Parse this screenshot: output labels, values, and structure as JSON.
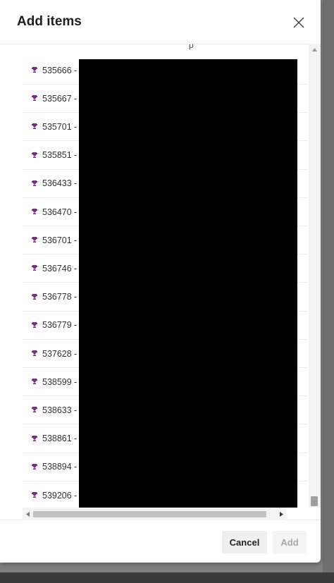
{
  "dialog": {
    "title": "Add items",
    "close_icon": "close-icon"
  },
  "list": {
    "clipped_top_text": "p",
    "item_icon": "trophy-icon",
    "item_icon_color": "#7b2a8c",
    "items": [
      {
        "id": "535666 -"
      },
      {
        "id": "535667 -"
      },
      {
        "id": "535701 -"
      },
      {
        "id": "535851 -"
      },
      {
        "id": "536433 -"
      },
      {
        "id": "536470 -"
      },
      {
        "id": "536701 -"
      },
      {
        "id": "536746 -"
      },
      {
        "id": "536778 -"
      },
      {
        "id": "536779 -"
      },
      {
        "id": "537628 -"
      },
      {
        "id": "538599 -"
      },
      {
        "id": "538633 -"
      },
      {
        "id": "538861 -"
      },
      {
        "id": "538894 -"
      },
      {
        "id": "539206 -"
      }
    ]
  },
  "footer": {
    "cancel_label": "Cancel",
    "add_label": "Add"
  }
}
